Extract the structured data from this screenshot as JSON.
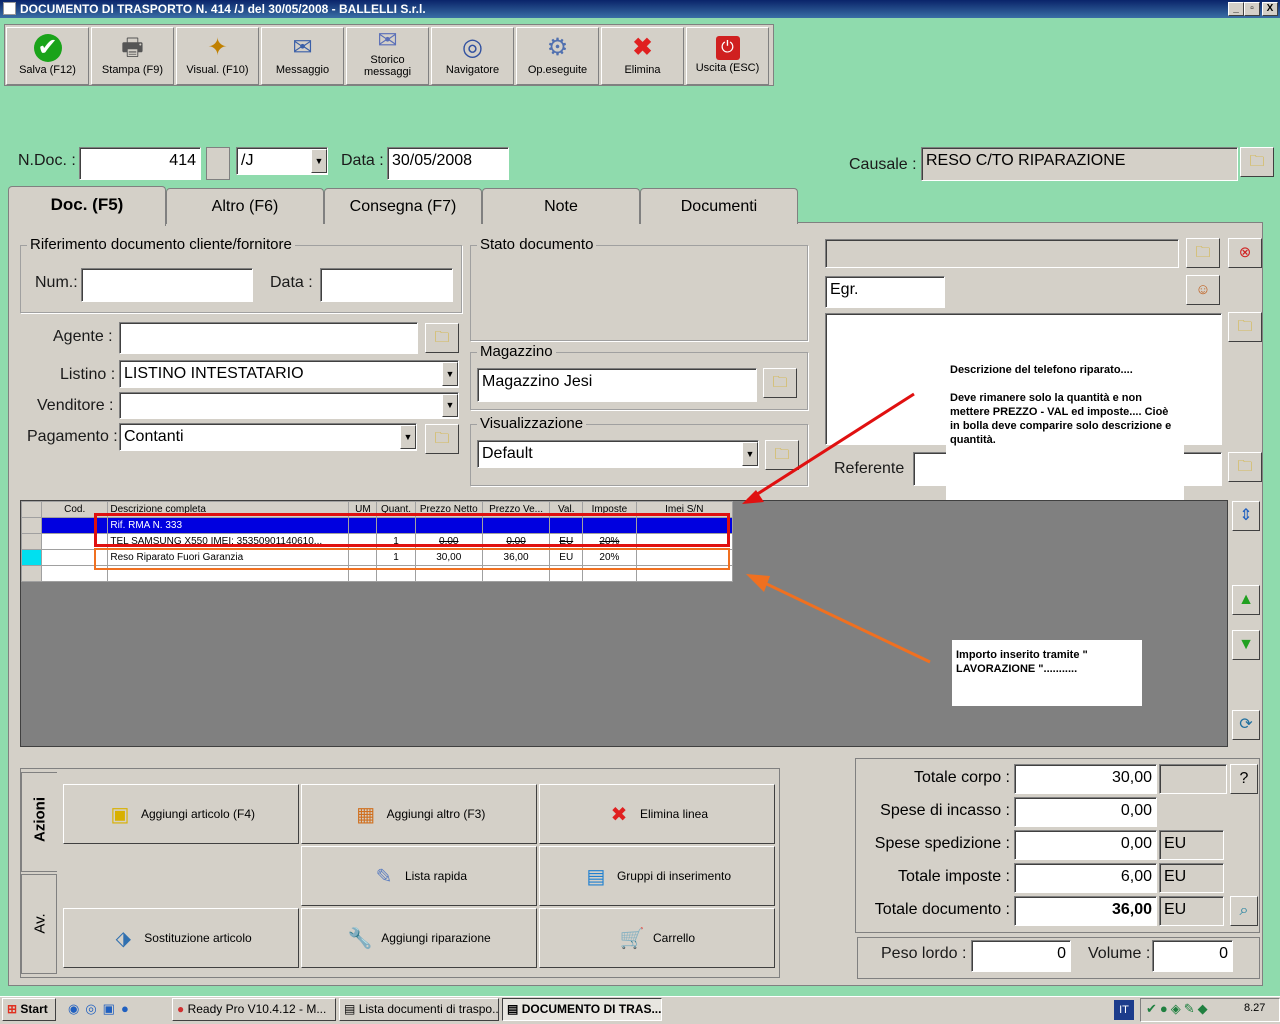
{
  "window": {
    "title": "DOCUMENTO DI TRASPORTO N. 414 /J del 30/05/2008 - BALLELLI S.r.l.",
    "min": "_",
    "max": "▫",
    "close": "X"
  },
  "toolbar": [
    {
      "label": "Salva (F12)",
      "icon": "check-icon"
    },
    {
      "label": "Stampa (F9)",
      "icon": "printer-icon"
    },
    {
      "label": "Visual. (F10)",
      "icon": "magic-wand-icon"
    },
    {
      "label": "Messaggio",
      "icon": "envelope-icon"
    },
    {
      "label": "Storico messaggi",
      "icon": "mail-history-icon"
    },
    {
      "label": "Navigatore",
      "icon": "navigator-icon"
    },
    {
      "label": "Op.eseguite",
      "icon": "gears-icon"
    },
    {
      "label": "Elimina",
      "icon": "delete-x-icon"
    },
    {
      "label": "Uscita (ESC)",
      "icon": "power-icon"
    }
  ],
  "header": {
    "ndoc_label": "N.Doc. :",
    "ndoc_value": "414",
    "series_value": "/J",
    "data_label": "Data :",
    "data_value": "30/05/2008",
    "causale_label": "Causale :",
    "causale_value": "RESO C/TO RIPARAZIONE"
  },
  "tabs": [
    "Doc. (F5)",
    "Altro (F6)",
    "Consegna (F7)",
    "Note",
    "Documenti"
  ],
  "riferimento": {
    "title": "Riferimento documento cliente/fornitore",
    "num_label": "Num.:",
    "num_value": "",
    "data_label": "Data :",
    "data_value": ""
  },
  "stato": {
    "title": "Stato documento"
  },
  "magazzino": {
    "title": "Magazzino",
    "value": "Magazzino Jesi"
  },
  "visualizzazione": {
    "title": "Visualizzazione",
    "value": "Default"
  },
  "form": {
    "agente_label": "Agente :",
    "agente_value": "",
    "listino_label": "Listino :",
    "listino_value": "LISTINO INTESTATARIO",
    "venditore_label": "Venditore :",
    "venditore_value": "",
    "pagamento_label": "Pagamento :",
    "pagamento_value": "Contanti"
  },
  "cliente": {
    "title_value": "Egr.",
    "referente_label": "Referente"
  },
  "grid": {
    "headers": [
      "",
      "Cod.",
      "Descrizione completa",
      "UM",
      "Quant.",
      "Prezzo Netto",
      "Prezzo Ve...",
      "Val.",
      "Imposte",
      "Imei S/N"
    ],
    "rows": [
      [
        "",
        "",
        "Rif. RMA N. 333",
        "",
        "",
        "",
        "",
        "",
        "",
        ""
      ],
      [
        "",
        "",
        "TEL SAMSUNG X550 IMEI: 35350901140610...",
        "",
        "1",
        "0,00",
        "0,00",
        "EU",
        "20%",
        ""
      ],
      [
        "",
        "",
        "Reso Riparato Fuori Garanzia",
        "",
        "1",
        "30,00",
        "36,00",
        "EU",
        "20%",
        ""
      ],
      [
        "",
        "",
        "",
        "",
        "",
        "",
        "",
        "",
        "",
        ""
      ]
    ]
  },
  "notes": {
    "top": "Descrizione del telefono riparato....\n\nDeve rimanere solo la quantità e non mettere PREZZO - VAL ed imposte.... Cioè in bolla deve comparire solo descrizione e quantità.",
    "bottom": "Importo inserito tramite \" LAVORAZIONE \"..........."
  },
  "actions": {
    "side_tab1": "Azioni",
    "side_tab2": "Av.",
    "buttons": [
      {
        "label": "Aggiungi articolo (F4)",
        "icon": "box-add-icon"
      },
      {
        "label": "Aggiungi altro (F3)",
        "icon": "grid-add-icon"
      },
      {
        "label": "Elimina linea",
        "icon": "delete-x-icon"
      },
      {
        "label": "Lista rapida",
        "icon": "quick-list-icon"
      },
      {
        "label": "Gruppi di inserimento",
        "icon": "group-insert-icon"
      },
      {
        "label": "Sostituzione articolo",
        "icon": "replace-item-icon"
      },
      {
        "label": "Aggiungi riparazione",
        "icon": "wrench-icon"
      },
      {
        "label": "Carrello",
        "icon": "cart-icon"
      }
    ]
  },
  "totals": {
    "corpo_label": "Totale corpo :",
    "corpo_value": "30,00",
    "incasso_label": "Spese di incasso :",
    "incasso_value": "0,00",
    "spedizione_label": "Spese spedizione :",
    "spedizione_value": "0,00",
    "spedizione_cur": "EU",
    "imposte_label": "Totale imposte :",
    "imposte_value": "6,00",
    "imposte_cur": "EU",
    "documento_label": "Totale documento :",
    "documento_value": "36,00",
    "documento_cur": "EU",
    "help": "?",
    "peso_label": "Peso lordo :",
    "peso_value": "0",
    "volume_label": "Volume :",
    "volume_value": "0"
  },
  "taskbar": {
    "start": "Start",
    "items": [
      "Ready Pro V10.4.12 - M...",
      "Lista documenti di traspo...",
      "DOCUMENTO DI TRAS..."
    ],
    "lang": "IT",
    "clock": "8.27"
  }
}
